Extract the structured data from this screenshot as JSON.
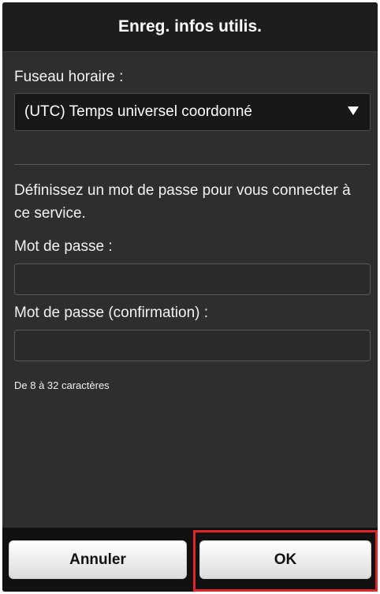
{
  "header": {
    "title": "Enreg. infos utilis."
  },
  "timezone": {
    "label": "Fuseau horaire :",
    "selected": "(UTC) Temps universel coordonné"
  },
  "password_section": {
    "intro": "Définissez un mot de passe pour vous connecter à ce service.",
    "password_label": "Mot de passe :",
    "password_value": "",
    "confirm_label": "Mot de passe (confirmation) :",
    "confirm_value": "",
    "hint": "De 8 à 32 caractères"
  },
  "footer": {
    "cancel_label": "Annuler",
    "ok_label": "OK"
  },
  "colors": {
    "background": "#2e2e2e",
    "titlebar": "#1d1d1d",
    "footer": "#111111",
    "highlight": "#e0262c"
  },
  "icons": {
    "dropdown": "triangle-down-icon"
  }
}
